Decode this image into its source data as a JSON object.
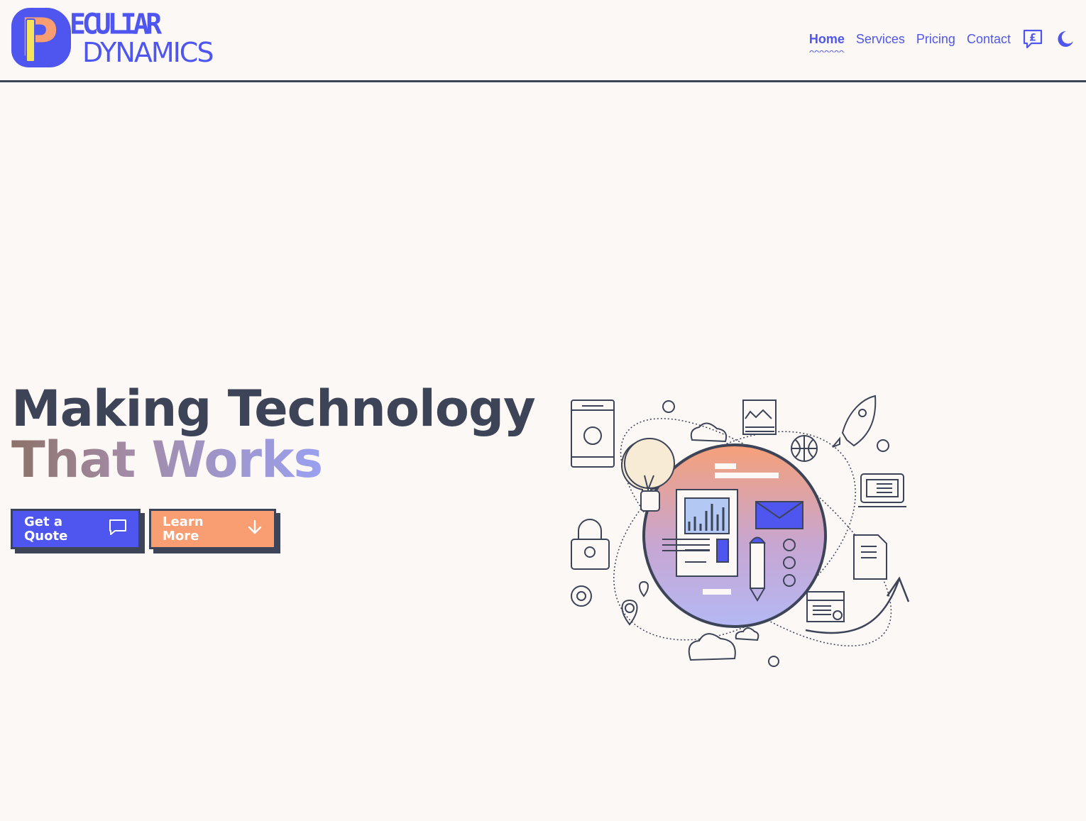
{
  "brand": {
    "logo_letter": "P",
    "logo_line1": "ECULIAR",
    "logo_line2": "DYNAMICS"
  },
  "nav": {
    "items": [
      {
        "label": "Home",
        "active": true
      },
      {
        "label": "Services",
        "active": false
      },
      {
        "label": "Pricing",
        "active": false
      },
      {
        "label": "Contact",
        "active": false
      }
    ],
    "quote_icon": "pound-chat-icon",
    "theme_icon": "moon-icon"
  },
  "hero": {
    "title_line1": "Making Technology",
    "title_line2": "That Works",
    "primary_button": {
      "label": "Get a Quote",
      "icon": "chat-bubble-icon"
    },
    "secondary_button": {
      "label": "Learn More",
      "icon": "arrow-down-icon"
    }
  },
  "colors": {
    "brand_blue": "#4f56f0",
    "brand_orange": "#f89e72",
    "ink": "#3d4457",
    "background": "#fcf8f5"
  }
}
